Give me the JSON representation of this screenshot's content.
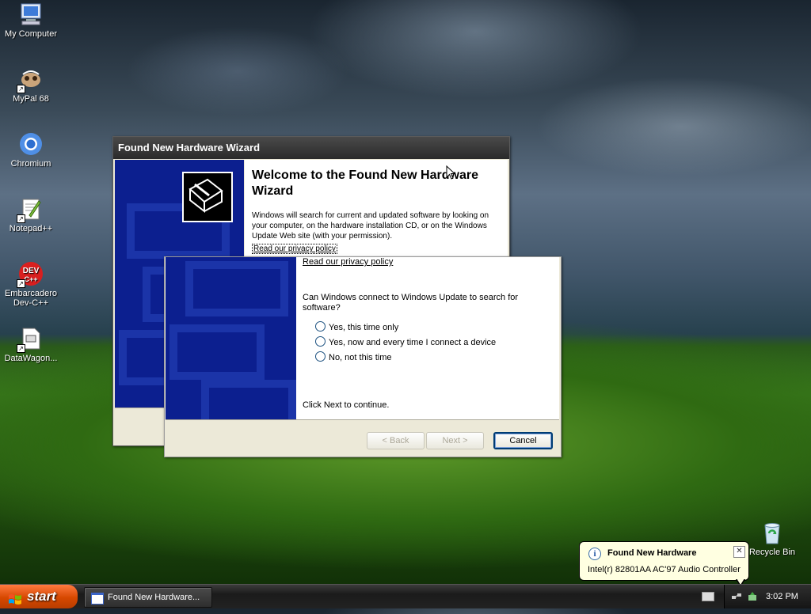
{
  "desktop": {
    "icons": [
      {
        "label": "My Computer",
        "icon": "computer-icon"
      },
      {
        "label": "MyPal 68",
        "icon": "mypal-icon"
      },
      {
        "label": "Chromium",
        "icon": "chromium-icon"
      },
      {
        "label": "Notepad++",
        "icon": "notepadpp-icon"
      },
      {
        "label": "Embarcadero Dev-C++",
        "icon": "devcpp-icon"
      },
      {
        "label": "DataWagon...",
        "icon": "file-icon"
      }
    ],
    "recycle_bin": "Recycle Bin"
  },
  "back_window": {
    "title": "Found New Hardware Wizard",
    "welcome_title": "Welcome to the Found New Hardware Wizard",
    "welcome_text": "Windows will search for current and updated software by looking on your computer, on the hardware installation CD, or on the Windows Update Web site (with your permission).",
    "privacy_link": "Read our privacy policy"
  },
  "front_window": {
    "privacy_link": "Read our privacy policy",
    "question": "Can Windows connect to Windows Update to search for software?",
    "options": [
      "Yes, this time only",
      "Yes, now and every time I connect a device",
      "No, not this time"
    ],
    "continue_text": "Click Next to continue.",
    "buttons": {
      "back": "< Back",
      "next": "Next >",
      "cancel": "Cancel"
    }
  },
  "balloon": {
    "title": "Found New Hardware",
    "text": "Intel(r) 82801AA AC'97 Audio Controller"
  },
  "taskbar": {
    "start": "start",
    "task": "Found New Hardware...",
    "clock": "3:02 PM"
  },
  "colors": {
    "wizard_blue": "#0c1f8f",
    "start_orange": "#d64800",
    "balloon_bg": "#ffffe1"
  }
}
